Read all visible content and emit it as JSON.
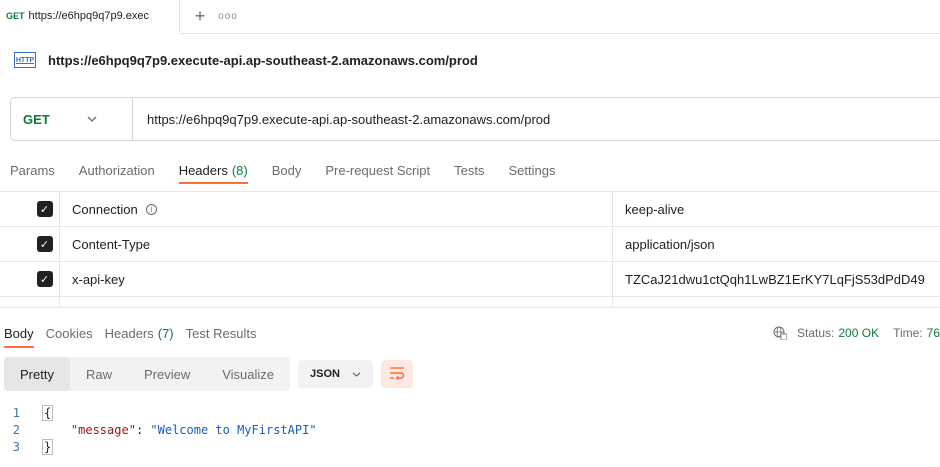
{
  "tab": {
    "method": "GET",
    "title": "https://e6hpq9q7p9.exec",
    "add_label": "+",
    "more_label": "ooo"
  },
  "request": {
    "icon_label": "HTTP",
    "name": "https://e6hpq9q7p9.execute-api.ap-southeast-2.amazonaws.com/prod",
    "method": "GET",
    "url": "https://e6hpq9q7p9.execute-api.ap-southeast-2.amazonaws.com/prod"
  },
  "request_tabs": [
    {
      "label": "Params"
    },
    {
      "label": "Authorization"
    },
    {
      "label": "Headers",
      "count": "(8)"
    },
    {
      "label": "Body"
    },
    {
      "label": "Pre-request Script"
    },
    {
      "label": "Tests"
    },
    {
      "label": "Settings"
    }
  ],
  "headers": [
    {
      "key": "Connection",
      "value": "keep-alive",
      "checked": true
    },
    {
      "key": "Content-Type",
      "value": "application/json",
      "checked": true
    },
    {
      "key": "x-api-key",
      "value": "TZCaJ21dwu1ctQqh1LwBZ1ErKY7LqFjS53dPdD49",
      "checked": true
    }
  ],
  "response_tabs": [
    {
      "label": "Body"
    },
    {
      "label": "Cookies"
    },
    {
      "label": "Headers",
      "count": "(7)"
    },
    {
      "label": "Test Results"
    }
  ],
  "status": {
    "status_label": "Status:",
    "status_value": "200 OK",
    "time_label": "Time:",
    "time_value": "76"
  },
  "view_modes": [
    "Pretty",
    "Raw",
    "Preview",
    "Visualize"
  ],
  "format": "JSON",
  "code": {
    "line_numbers": [
      "1",
      "2",
      "3"
    ],
    "open": "{",
    "key": "\"message\"",
    "colon": ": ",
    "value": "\"Welcome to MyFirstAPI\"",
    "close": "}"
  },
  "colors": {
    "accent": "#ff6c37",
    "method_get": "#0d7a3b",
    "status_ok": "#0d7a3b"
  }
}
